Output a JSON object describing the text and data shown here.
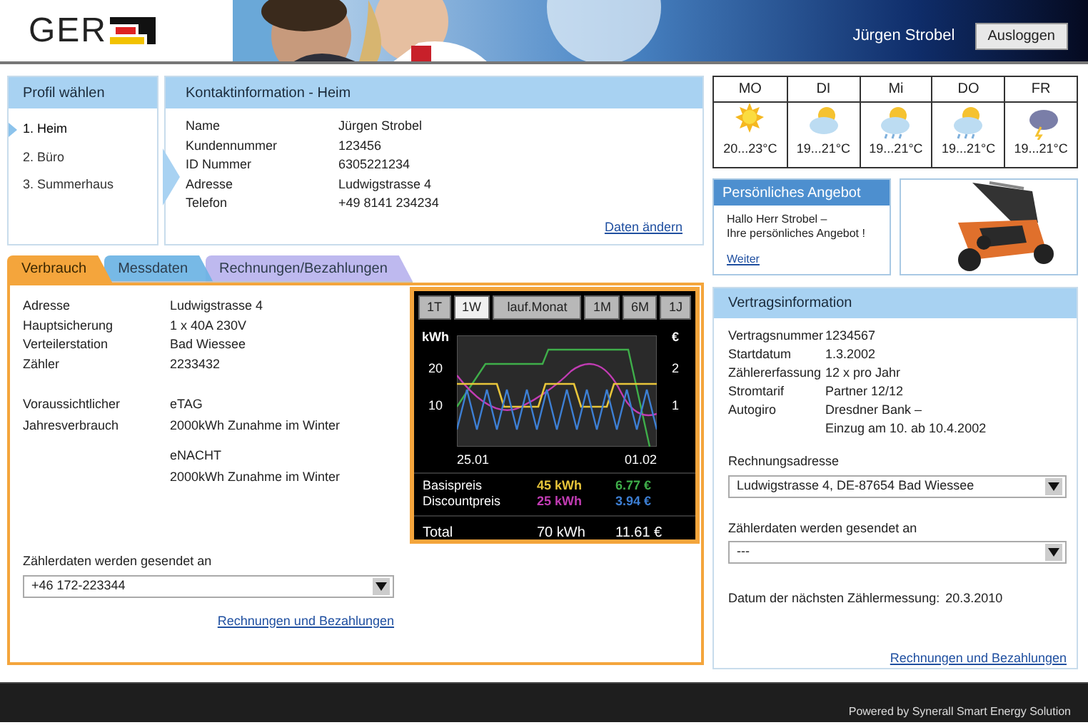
{
  "header": {
    "logo": "GER",
    "user": "Jürgen Strobel",
    "logout": "Ausloggen"
  },
  "profiles": {
    "title": "Profil wählen",
    "items": [
      {
        "label": "1. Heim",
        "selected": true
      },
      {
        "label": "2. Büro",
        "selected": false
      },
      {
        "label": "3. Summerhaus",
        "selected": false
      }
    ]
  },
  "contact": {
    "title": "Kontaktinformation - Heim",
    "rows": [
      {
        "label": "Name",
        "value": "Jürgen Strobel"
      },
      {
        "label": "Kundennummer",
        "value": "123456"
      },
      {
        "label": "ID Nummer",
        "value": "6305221234"
      },
      {
        "label": "Adresse",
        "value": "Ludwigstrasse 4"
      },
      {
        "label": "Telefon",
        "value": "+49 8141 234234"
      }
    ],
    "link": "Daten ändern"
  },
  "weather": [
    {
      "day": "MO",
      "kind": "sun",
      "temp": "20...23°C"
    },
    {
      "day": "DI",
      "kind": "cloud",
      "temp": "19...21°C"
    },
    {
      "day": "Mi",
      "kind": "rain",
      "temp": "19...21°C"
    },
    {
      "day": "DO",
      "kind": "rain",
      "temp": "19...21°C"
    },
    {
      "day": "FR",
      "kind": "storm",
      "temp": "19...21°C"
    }
  ],
  "offer": {
    "title": "Persönliches Angebot",
    "lines": [
      "Hallo Herr Strobel –",
      "Ihre persönliches Angebot !"
    ],
    "link": "Weiter"
  },
  "tabs": [
    {
      "label": "Verbrauch",
      "selected": true,
      "color": "#f4a53c"
    },
    {
      "label": "Messdaten",
      "selected": false,
      "color": "#6cb4e4"
    },
    {
      "label": "Rechnungen/Bezahlungen",
      "selected": false,
      "color": "#b9b4ee"
    }
  ],
  "usage": {
    "rows": [
      {
        "label": "Adresse",
        "values": [
          "Ludwigstrasse 4"
        ]
      },
      {
        "label": "Hauptsicherung",
        "values": [
          "1 x 40A 230V"
        ]
      },
      {
        "label": "Verteilerstation",
        "values": [
          "Bad Wiessee"
        ]
      },
      {
        "label": "Zähler",
        "values": [
          "2233432"
        ]
      }
    ],
    "forecast": {
      "labels": [
        "Voraussichtlicher",
        "Jahresverbrauch"
      ],
      "values": [
        "eTAG",
        "2000kWh Zunahme im Winter",
        "eNACHT",
        "2000kWh Zunahme im Winter"
      ]
    },
    "send_label": "Zählerdaten werden gesendet an",
    "send_value": "+46 172-223344",
    "link": "Rechnungen und Bezahlungen"
  },
  "meter": {
    "periods": [
      {
        "label": "1T",
        "selected": false
      },
      {
        "label": "1W",
        "selected": true
      },
      {
        "label": "lauf.Monat",
        "selected": false
      },
      {
        "label": "1M",
        "selected": false
      },
      {
        "label": "6M",
        "selected": false
      },
      {
        "label": "1J",
        "selected": false
      }
    ],
    "left_unit": "kWh",
    "left_ticks": [
      "20",
      "10"
    ],
    "right_unit": "€",
    "right_ticks": [
      "2",
      "1"
    ],
    "x_labels": [
      "25.01",
      "01.02"
    ],
    "legend": [
      {
        "label": "Basispreis",
        "kwh": {
          "text": "45 kWh",
          "color": "#e8c53a"
        },
        "eur": {
          "text": "6.77 €",
          "color": "#3fae4a"
        }
      },
      {
        "label": "Discountpreis",
        "kwh": {
          "text": "25 kWh",
          "color": "#c23cb4"
        },
        "eur": {
          "text": "3.94 €",
          "color": "#3d7fd4"
        }
      }
    ],
    "total": {
      "label": "Total",
      "kwh": "70 kWh",
      "eur": "11.61 €"
    }
  },
  "contract": {
    "title": "Vertragsinformation",
    "rows": [
      {
        "label": "Vertragsnummer",
        "values": [
          "1234567"
        ]
      },
      {
        "label": "Startdatum",
        "values": [
          "1.3.2002"
        ]
      },
      {
        "label": "Zählererfassung",
        "values": [
          "12 x pro Jahr"
        ]
      },
      {
        "label": "Stromtarif",
        "values": [
          "Partner 12/12"
        ]
      },
      {
        "label": "Autogiro",
        "values": [
          "Dresdner Bank –",
          "Einzug am 10. ab 10.4.2002"
        ]
      }
    ],
    "address_label": "Rechnungsadresse",
    "address_value": "Ludwigstrasse 4, DE-87654 Bad Wiessee",
    "send_label": "Zählerdaten werden gesendet an",
    "send_value": "---",
    "next_label": "Datum der nächsten Zählermessung:",
    "next_value": "20.3.2010",
    "link": "Rechnungen und Bezahlungen"
  },
  "footer": "Powered by Synerall Smart Energy Solution"
}
